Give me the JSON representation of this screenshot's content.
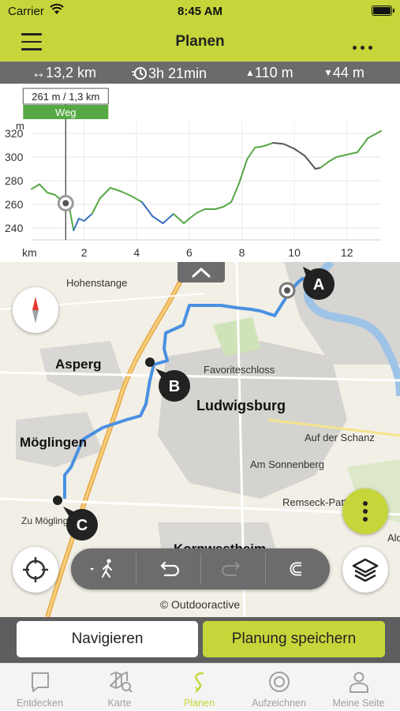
{
  "status_bar": {
    "carrier": "Carrier",
    "time": "8:45 AM"
  },
  "header": {
    "title": "Planen"
  },
  "stats": {
    "distance": "13,2 km",
    "duration": "3h 21min",
    "ascent": "110 m",
    "descent": "44 m"
  },
  "chart_data": {
    "type": "line",
    "xlabel": "km",
    "ylabel": "m",
    "x_ticks": [
      "2",
      "4",
      "6",
      "8",
      "10",
      "12"
    ],
    "y_ticks": [
      "240",
      "260",
      "280",
      "300",
      "320"
    ],
    "xlim": [
      0,
      13.3
    ],
    "ylim": [
      230,
      330
    ],
    "series": [
      {
        "x": [
          0,
          0.3,
          0.6,
          0.9,
          1.2,
          1.4,
          1.6,
          1.8,
          2.0,
          2.3,
          2.6,
          3.0,
          3.4,
          3.8,
          4.2,
          4.6,
          5.0,
          5.4,
          5.8,
          6.0,
          6.3,
          6.6,
          7.0,
          7.3,
          7.6,
          7.9,
          8.2,
          8.5,
          8.8,
          9.2,
          9.6,
          10.0,
          10.4,
          10.8,
          11.0,
          11.3,
          11.6,
          12.0,
          12.4,
          12.8,
          13.3
        ],
        "y": [
          273,
          277,
          270,
          268,
          262,
          262,
          238,
          248,
          246,
          252,
          265,
          274,
          271,
          267,
          262,
          250,
          244,
          252,
          244,
          248,
          253,
          256,
          256,
          258,
          262,
          278,
          298,
          308,
          309,
          312,
          311,
          307,
          301,
          290,
          291,
          296,
          300,
          302,
          304,
          316,
          322
        ]
      }
    ],
    "marker": {
      "x": 1.3,
      "y": 261,
      "label": "261 m / 1,3 km",
      "surface": "Weg"
    },
    "surface_colors": {
      "weg": "#56a845",
      "road": "#3a6fc0",
      "path": "#d9534f",
      "unknown": "#555555"
    }
  },
  "map": {
    "labels": {
      "hohenstange": "Hohenstange",
      "asperg": "Asperg",
      "favoriteschloss": "Favoriteschloss",
      "ludwigsburg": "Ludwigsburg",
      "auf_der_schanz": "Auf der Schanz",
      "am_sonnenberg": "Am Sonnenberg",
      "moeglingen": "Möglingen",
      "remseck": "Remseck-Patte",
      "zu_moeglingen": "Zu Mögling",
      "ald": "Ald",
      "kornwestheim": "Kornwestheim"
    },
    "waypoints": {
      "a": "A",
      "b": "B",
      "c": "C"
    },
    "copyright": "© Outdooractive",
    "route_color": "#4a90e2"
  },
  "actions": {
    "navigate": "Navigieren",
    "save": "Planung speichern"
  },
  "tabs": [
    {
      "label": "Entdecken"
    },
    {
      "label": "Karte"
    },
    {
      "label": "Planen"
    },
    {
      "label": "Aufzeichnen"
    },
    {
      "label": "Meine Seite"
    }
  ],
  "colors": {
    "accent": "#c6d63a",
    "stats_bar": "#6b6b6b"
  }
}
